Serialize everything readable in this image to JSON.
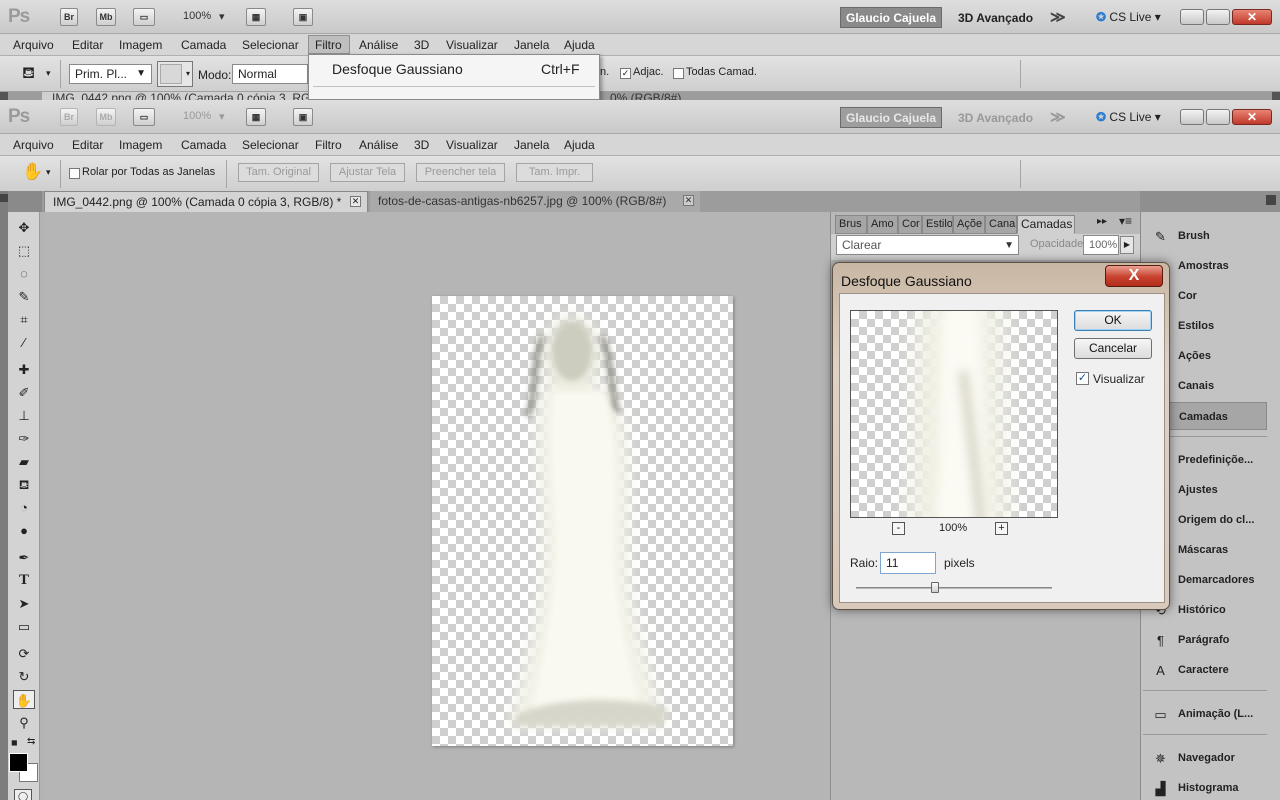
{
  "app": {
    "logo": "Ps",
    "bridge": "Br",
    "minibridge": "Mb",
    "zoom": "100%",
    "user": "Glaucio Cajuela",
    "workspace": "3D Avançado",
    "more": "≫",
    "cslive": "CS Live"
  },
  "menu": [
    "Arquivo",
    "Editar",
    "Imagem",
    "Camada",
    "Selecionar",
    "Filtro",
    "Análise",
    "3D",
    "Visualizar",
    "Janela",
    "Ajuda"
  ],
  "options_back": {
    "preset": "Prim. Pl...",
    "mode_label": "Modo:",
    "mode_value": "Normal",
    "partial": "n.",
    "adjac": "Adjac.",
    "todas": "Todas Camad."
  },
  "filter_dropdown": {
    "item": "Desfoque Gaussiano",
    "shortcut": "Ctrl+F"
  },
  "back_tab_fragments": {
    "left": "IMG_0442.png @ 100% (Camada 0 cópia 3, RG",
    "right": "0% (RGB/8#)"
  },
  "options_front": {
    "scroll_all": "Rolar por Todas as Janelas",
    "btn1": "Tam. Original",
    "btn2": "Ajustar Tela",
    "btn3": "Preencher tela",
    "btn4": "Tam. Impr."
  },
  "doc_tabs": [
    "IMG_0442.png @ 100% (Camada 0 cópia 3, RGB/8) *",
    "fotos-de-casas-antigas-nb6257.jpg @ 100% (RGB/8#)"
  ],
  "layers_panel": {
    "tabs": [
      "Brus",
      "Amo",
      "Cor",
      "Estilo",
      "Açõe",
      "Cana",
      "Camadas"
    ],
    "blend_mode": "Clarear",
    "opacity_label": "Opacidade:",
    "opacity_value": "100%"
  },
  "dock": [
    "Brush",
    "Amostras",
    "Cor",
    "Estilos",
    "Ações",
    "Canais",
    "Camadas",
    "Predefiniçõe...",
    "Ajustes",
    "Origem do cl...",
    "Máscaras",
    "Demarcadores",
    "Histórico",
    "Parágrafo",
    "Caractere",
    "Animação (L...",
    "Navegador",
    "Histograma"
  ],
  "dialog": {
    "title": "Desfoque Gaussiano",
    "close": "X",
    "ok": "OK",
    "cancel": "Cancelar",
    "preview_label": "Visualizar",
    "zoom_minus": "-",
    "zoom_plus": "+",
    "zoom": "100%",
    "radius_label": "Raio:",
    "radius_value": "11",
    "radius_unit": "pixels"
  }
}
